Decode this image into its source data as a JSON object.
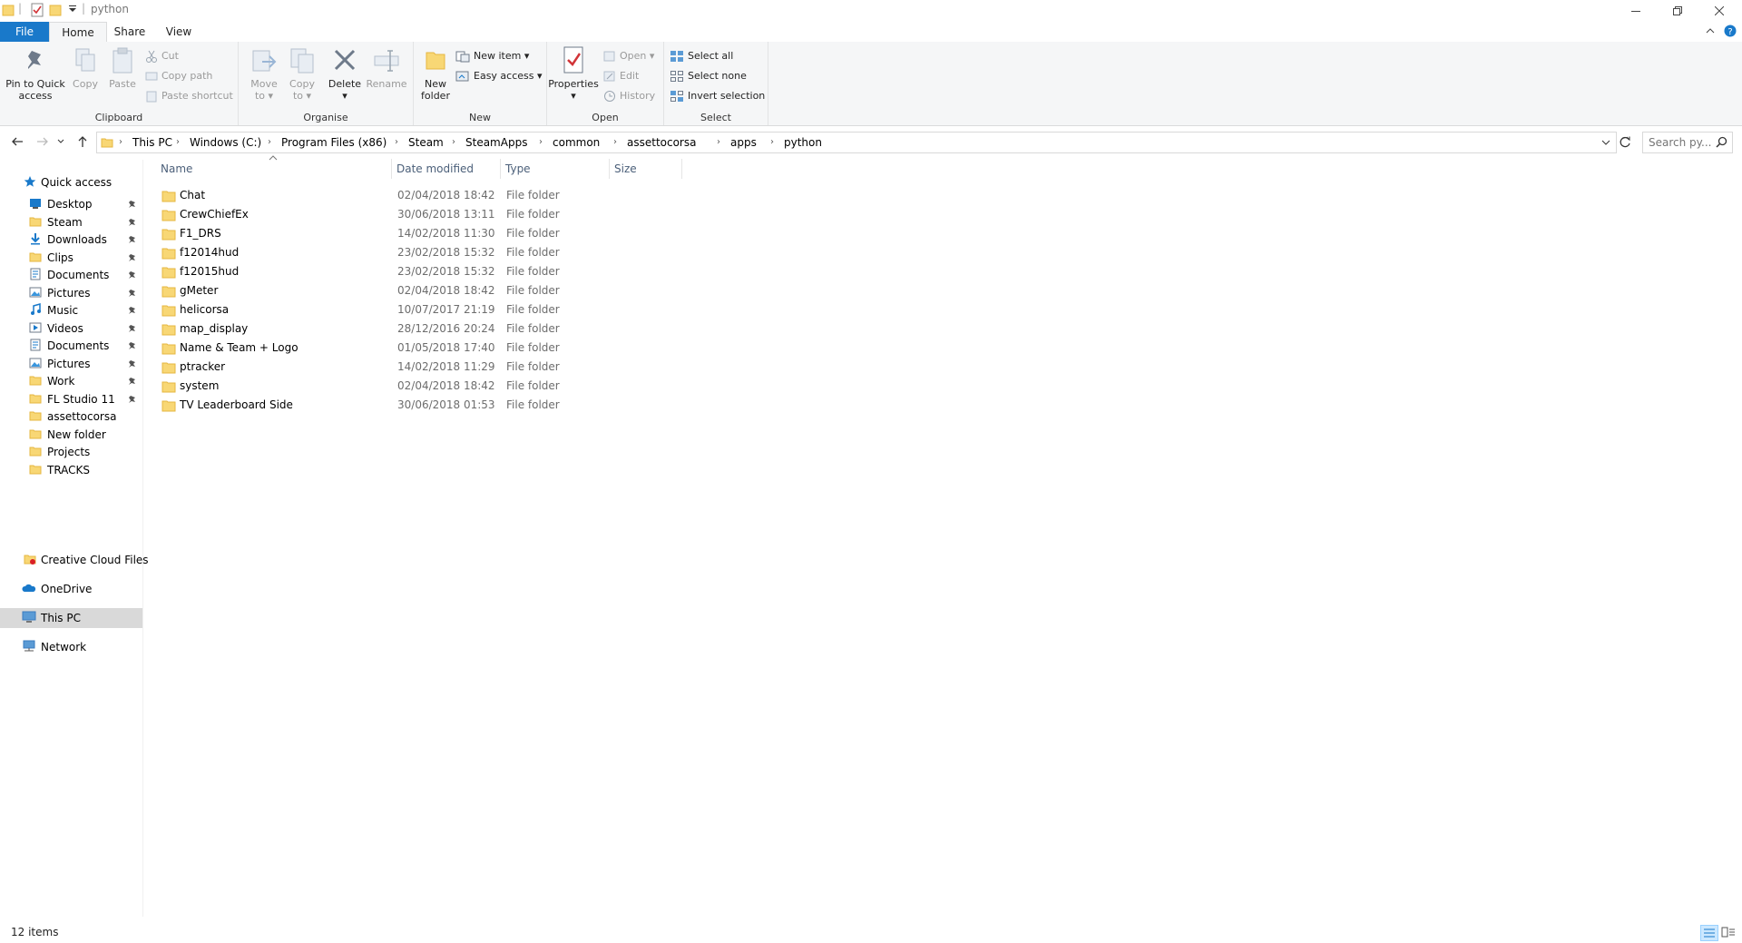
{
  "window": {
    "title": "python",
    "controls": {
      "minimize": "minimize",
      "restore": "restore",
      "close": "close"
    }
  },
  "ribbon_tabs": {
    "file": "File",
    "home": "Home",
    "share": "Share",
    "view": "View"
  },
  "ribbon": {
    "clipboard": {
      "label": "Clipboard",
      "pin_line1": "Pin to Quick",
      "pin_line2": "access",
      "copy": "Copy",
      "paste": "Paste",
      "cut": "Cut",
      "copy_path": "Copy path",
      "paste_shortcut": "Paste shortcut"
    },
    "organise": {
      "label": "Organise",
      "move_line1": "Move",
      "move_line2": "to",
      "copy_line1": "Copy",
      "copy_line2": "to",
      "delete": "Delete",
      "rename": "Rename"
    },
    "new": {
      "label": "New",
      "folder_line1": "New",
      "folder_line2": "folder",
      "new_item": "New item",
      "easy_access": "Easy access"
    },
    "open": {
      "label": "Open",
      "properties": "Properties",
      "open": "Open",
      "edit": "Edit",
      "history": "History"
    },
    "select": {
      "label": "Select",
      "select_all": "Select all",
      "select_none": "Select none",
      "invert": "Invert selection"
    }
  },
  "address": {
    "crumbs": [
      "This PC",
      "Windows (C:)",
      "Program Files (x86)",
      "Steam",
      "SteamApps",
      "common",
      "assettocorsa",
      "apps",
      "python"
    ],
    "search_placeholder": "Search py..."
  },
  "nav_pane": {
    "quick_access": "Quick access",
    "items": [
      {
        "label": "Desktop",
        "icon": "desktop-icon",
        "pinned": true
      },
      {
        "label": "Steam",
        "icon": "folder-icon",
        "pinned": true
      },
      {
        "label": "Downloads",
        "icon": "downloads-icon",
        "pinned": true
      },
      {
        "label": "Clips",
        "icon": "folder-icon",
        "pinned": true
      },
      {
        "label": "Documents",
        "icon": "documents-icon",
        "pinned": true
      },
      {
        "label": "Pictures",
        "icon": "pictures-icon",
        "pinned": true
      },
      {
        "label": "Music",
        "icon": "music-icon",
        "pinned": true
      },
      {
        "label": "Videos",
        "icon": "videos-icon",
        "pinned": true
      },
      {
        "label": "Documents",
        "icon": "documents-icon",
        "pinned": true
      },
      {
        "label": "Pictures",
        "icon": "pictures-icon",
        "pinned": true
      },
      {
        "label": "Work",
        "icon": "folder-icon",
        "pinned": true
      },
      {
        "label": "FL Studio 11",
        "icon": "folder-icon",
        "pinned": true
      },
      {
        "label": "assettocorsa",
        "icon": "folder-icon",
        "pinned": false
      },
      {
        "label": "New folder",
        "icon": "folder-icon",
        "pinned": false
      },
      {
        "label": "Projects",
        "icon": "folder-icon",
        "pinned": false
      },
      {
        "label": "TRACKS",
        "icon": "folder-icon",
        "pinned": false
      }
    ],
    "creative_cloud": "Creative Cloud Files",
    "onedrive": "OneDrive",
    "this_pc": "This PC",
    "network": "Network"
  },
  "columns": {
    "name": "Name",
    "date": "Date modified",
    "type": "Type",
    "size": "Size"
  },
  "files": [
    {
      "name": "Chat",
      "date": "02/04/2018 18:42",
      "type": "File folder"
    },
    {
      "name": "CrewChiefEx",
      "date": "30/06/2018 13:11",
      "type": "File folder"
    },
    {
      "name": "F1_DRS",
      "date": "14/02/2018 11:30",
      "type": "File folder"
    },
    {
      "name": "f12014hud",
      "date": "23/02/2018 15:32",
      "type": "File folder"
    },
    {
      "name": "f12015hud",
      "date": "23/02/2018 15:32",
      "type": "File folder"
    },
    {
      "name": "gMeter",
      "date": "02/04/2018 18:42",
      "type": "File folder"
    },
    {
      "name": "helicorsa",
      "date": "10/07/2017 21:19",
      "type": "File folder"
    },
    {
      "name": "map_display",
      "date": "28/12/2016 20:24",
      "type": "File folder"
    },
    {
      "name": "Name & Team + Logo",
      "date": "01/05/2018 17:40",
      "type": "File folder"
    },
    {
      "name": "ptracker",
      "date": "14/02/2018 11:29",
      "type": "File folder"
    },
    {
      "name": "system",
      "date": "02/04/2018 18:42",
      "type": "File folder"
    },
    {
      "name": "TV Leaderboard Side",
      "date": "30/06/2018 01:53",
      "type": "File folder"
    }
  ],
  "status": {
    "item_count": "12 items"
  },
  "colors": {
    "accent": "#1979ca",
    "folder": "#f8d775",
    "folder_dark": "#e6b741",
    "ribbon_bg": "#f5f6f7",
    "selected": "#d9d9d9"
  }
}
